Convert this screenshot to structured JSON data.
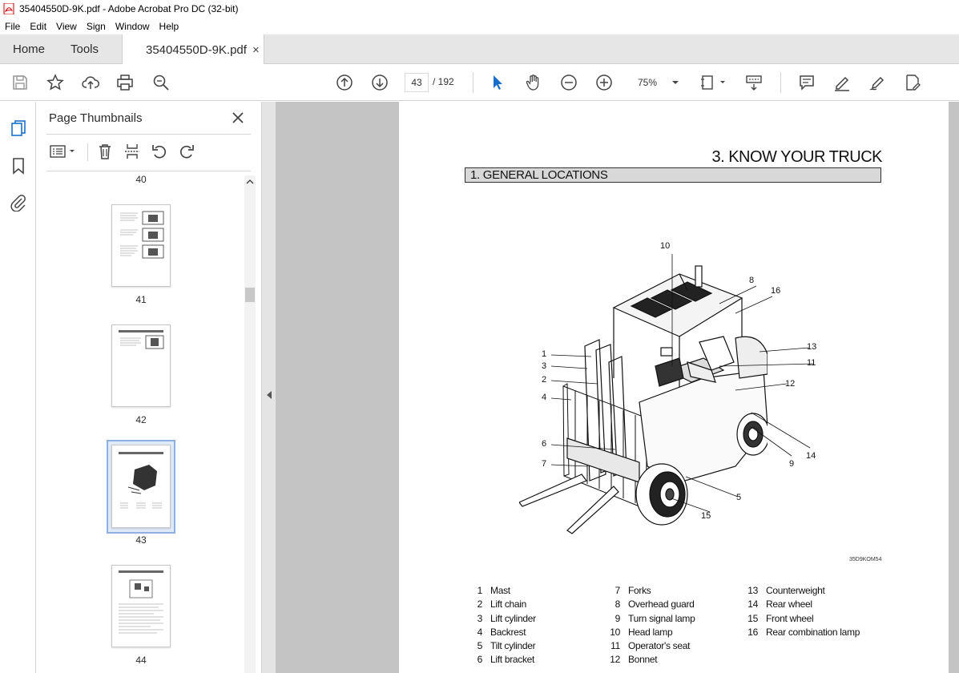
{
  "window": {
    "title": "35404550D-9K.pdf - Adobe Acrobat Pro DC (32-bit)"
  },
  "menu": [
    "File",
    "Edit",
    "View",
    "Sign",
    "Window",
    "Help"
  ],
  "tabs": {
    "home": "Home",
    "tools": "Tools",
    "document": "35404550D-9K.pdf",
    "close": "×"
  },
  "toolbar": {
    "current_page": "43",
    "total_pages": "/ 192",
    "zoom": "75%"
  },
  "panel": {
    "title": "Page Thumbnails",
    "thumbnails": [
      {
        "page": "40"
      },
      {
        "page": "41"
      },
      {
        "page": "42"
      },
      {
        "page": "43",
        "selected": true
      },
      {
        "page": "44"
      }
    ]
  },
  "document_page": {
    "chapter": "3. KNOW YOUR TRUCK",
    "section": "1. GENERAL LOCATIONS",
    "figure_code": "35D9KOM54",
    "callouts": [
      "1",
      "2",
      "3",
      "4",
      "5",
      "6",
      "7",
      "8",
      "9",
      "10",
      "11",
      "12",
      "13",
      "14",
      "15",
      "16"
    ],
    "legend": [
      [
        {
          "n": "1",
          "t": "Mast"
        },
        {
          "n": "2",
          "t": "Lift chain"
        },
        {
          "n": "3",
          "t": "Lift cylinder"
        },
        {
          "n": "4",
          "t": "Backrest"
        },
        {
          "n": "5",
          "t": "Tilt cylinder"
        },
        {
          "n": "6",
          "t": "Lift bracket"
        }
      ],
      [
        {
          "n": "7",
          "t": "Forks"
        },
        {
          "n": "8",
          "t": "Overhead guard"
        },
        {
          "n": "9",
          "t": "Turn signal lamp"
        },
        {
          "n": "10",
          "t": "Head lamp"
        },
        {
          "n": "11",
          "t": "Operator's seat"
        },
        {
          "n": "12",
          "t": "Bonnet"
        }
      ],
      [
        {
          "n": "13",
          "t": "Counterweight"
        },
        {
          "n": "14",
          "t": "Rear wheel"
        },
        {
          "n": "15",
          "t": "Front wheel"
        },
        {
          "n": "16",
          "t": "Rear combination lamp"
        }
      ]
    ]
  },
  "colors": {
    "accent": "#1a6fc9",
    "viewer_bg": "#c4c4c4"
  }
}
